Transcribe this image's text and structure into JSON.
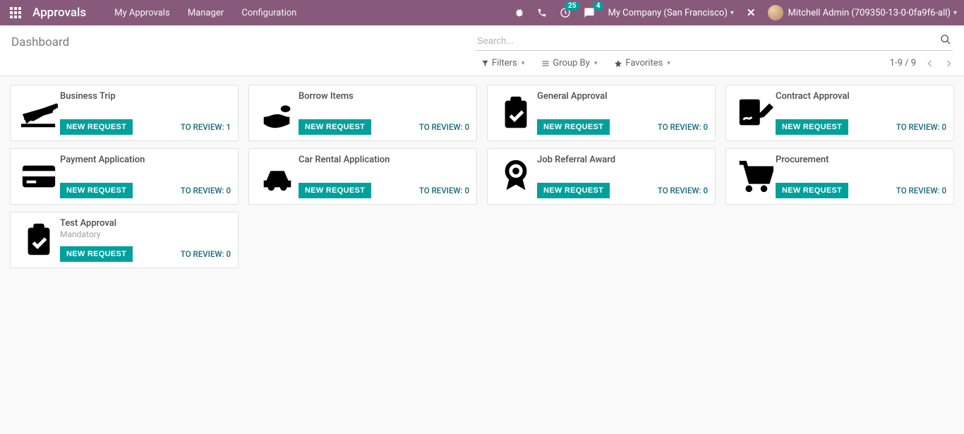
{
  "nav": {
    "brand": "Approvals",
    "menu": [
      "My Approvals",
      "Manager",
      "Configuration"
    ],
    "clock_badge": "25",
    "chat_badge": "4",
    "company": "My Company (San Francisco)",
    "user": "Mitchell Admin (709350-13-0-0fa9f6-all)"
  },
  "breadcrumb": "Dashboard",
  "search": {
    "placeholder": "Search..."
  },
  "tools": {
    "filters": "Filters",
    "groupby": "Group By",
    "favorites": "Favorites"
  },
  "pager": "1-9 / 9",
  "button_label": "NEW REQUEST",
  "cards": [
    {
      "title": "Business Trip",
      "sub": "",
      "review_label": "TO REVIEW: 1",
      "icon": "plane"
    },
    {
      "title": "Borrow Items",
      "sub": "",
      "review_label": "TO REVIEW: 0",
      "icon": "hand"
    },
    {
      "title": "General Approval",
      "sub": "",
      "review_label": "TO REVIEW: 0",
      "icon": "clipboard"
    },
    {
      "title": "Contract Approval",
      "sub": "",
      "review_label": "TO REVIEW: 0",
      "icon": "sign"
    },
    {
      "title": "Payment Application",
      "sub": "",
      "review_label": "TO REVIEW: 0",
      "icon": "card"
    },
    {
      "title": "Car Rental Application",
      "sub": "",
      "review_label": "TO REVIEW: 0",
      "icon": "car"
    },
    {
      "title": "Job Referral Award",
      "sub": "",
      "review_label": "TO REVIEW: 0",
      "icon": "award"
    },
    {
      "title": "Procurement",
      "sub": "",
      "review_label": "TO REVIEW: 0",
      "icon": "cart"
    },
    {
      "title": "Test Approval",
      "sub": "Mandatory",
      "review_label": "TO REVIEW: 0",
      "icon": "clipboard"
    }
  ]
}
